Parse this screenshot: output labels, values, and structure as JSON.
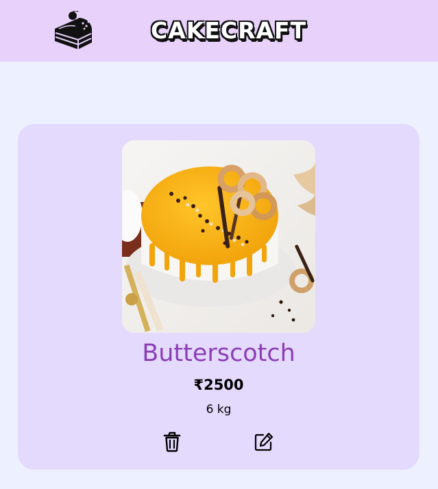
{
  "header": {
    "brand_name": "CAKECRAFT",
    "logo_icon": "cake-slice-icon"
  },
  "colors": {
    "header_bg": "#e8d1fb",
    "page_bg": "#edf0ff",
    "card_bg": "#e4dafd",
    "name_color": "#8b3db5"
  },
  "cake": {
    "name": "Butterscotch",
    "price": "₹2500",
    "weight": "6 kg",
    "photo_description": "butterscotch-cake-photo"
  },
  "actions": {
    "delete_icon": "trash-icon",
    "edit_icon": "edit-icon"
  }
}
